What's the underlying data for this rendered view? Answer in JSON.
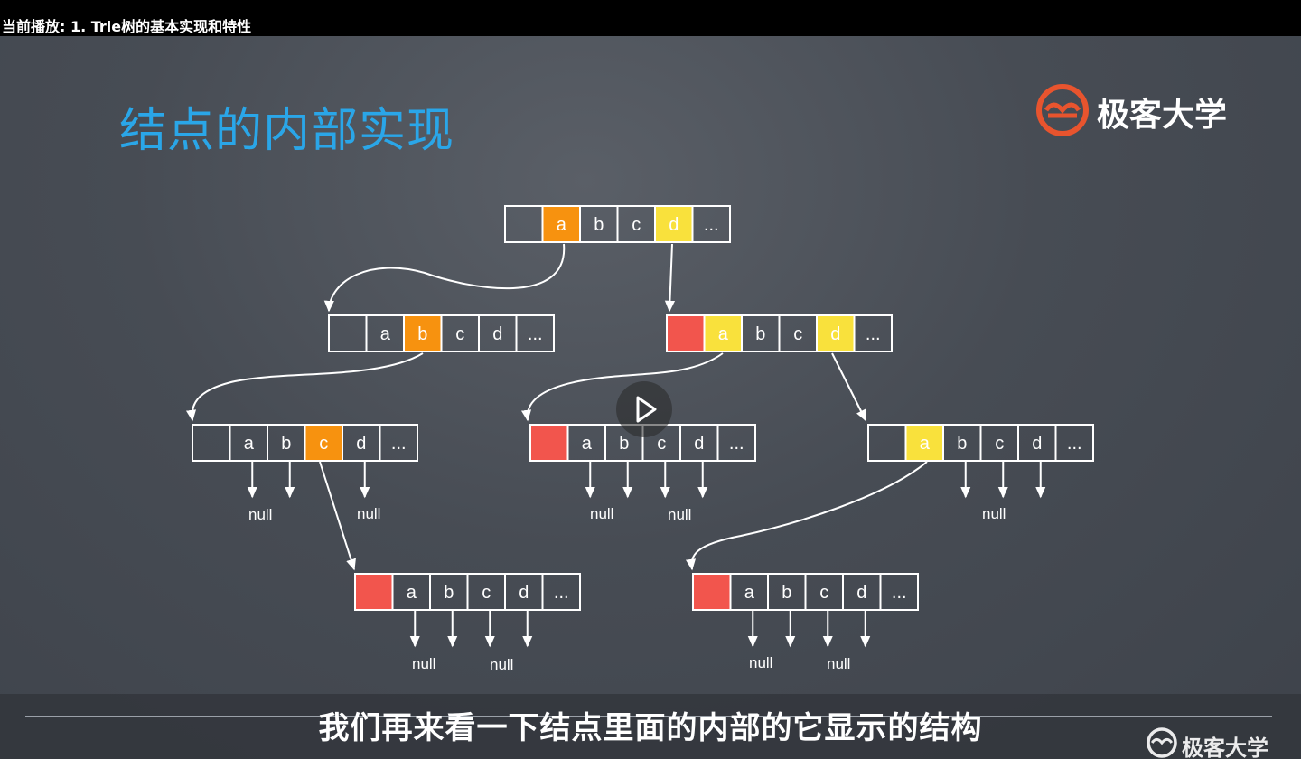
{
  "header": {
    "now_playing": "当前播放: 1. Trie树的基本实现和特性"
  },
  "slide": {
    "title": "结点的内部实现",
    "brand": "极客大学",
    "subtitle": "我们再来看一下结点里面的内部的它显示的结构",
    "watermark": "极客大学"
  },
  "colors": {
    "title": "#2aa6e8",
    "orange": "#f7920f",
    "yellow": "#f9e13c",
    "red": "#f2554d",
    "logo": "#e8542e"
  },
  "diagram": {
    "cell_labels": [
      "a",
      "b",
      "c",
      "d",
      "..."
    ],
    "null_label": "null",
    "nodes": [
      {
        "id": "root",
        "fills": [
          "",
          "orange",
          "",
          "",
          "yellow",
          ""
        ]
      },
      {
        "id": "n-a",
        "fills": [
          "",
          "",
          "orange",
          "",
          "",
          ""
        ]
      },
      {
        "id": "n-d",
        "fills": [
          "red",
          "yellow",
          "",
          "",
          "yellow",
          ""
        ]
      },
      {
        "id": "n-ab",
        "fills": [
          "",
          "",
          "",
          "orange",
          "",
          ""
        ]
      },
      {
        "id": "n-da",
        "fills": [
          "red",
          "",
          "",
          "",
          "",
          ""
        ]
      },
      {
        "id": "n-dd",
        "fills": [
          "",
          "yellow",
          "",
          "",
          "",
          ""
        ]
      },
      {
        "id": "n-abc",
        "fills": [
          "red",
          "",
          "",
          "",
          "",
          ""
        ]
      },
      {
        "id": "n-dda",
        "fills": [
          "red",
          "",
          "",
          "",
          "",
          ""
        ]
      }
    ]
  },
  "player": {
    "play_icon": "play-icon"
  }
}
